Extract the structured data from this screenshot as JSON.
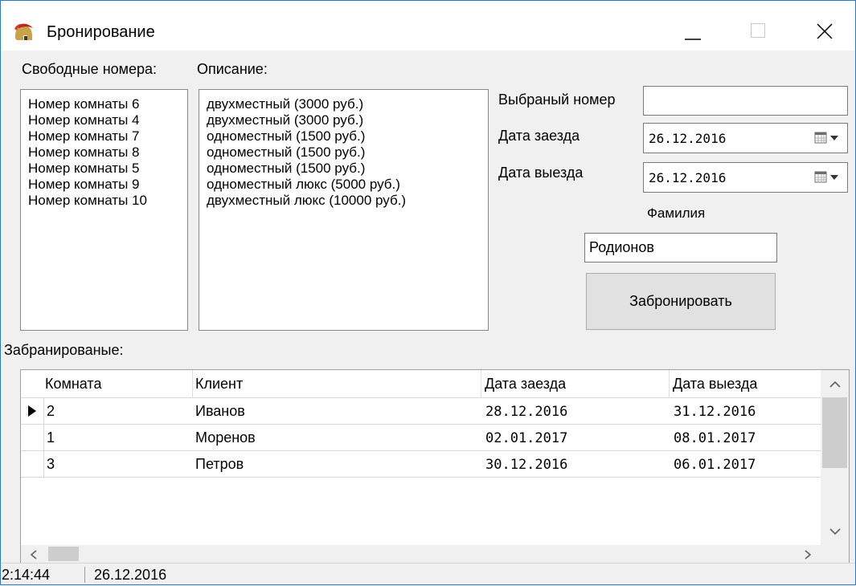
{
  "window": {
    "title": "Бронирование",
    "icon": "spartan-helmet-icon",
    "minimize_icon": "minimize-icon",
    "maximize_icon": "maximize-icon",
    "close_icon": "close-icon"
  },
  "rooms": {
    "label": "Свободные номера:",
    "items": [
      "Номер комнаты 6",
      "Номер комнаты 4",
      "Номер комнаты 7",
      "Номер комнаты 8",
      "Номер комнаты 5",
      "Номер комнаты 9",
      "Номер комнаты 10"
    ]
  },
  "description": {
    "label": "Описание:",
    "items": [
      "двухместный (3000 руб.)",
      "двухместный (3000 руб.)",
      "одноместный (1500 руб.)",
      "одноместный (1500 руб.)",
      "одноместный (1500 руб.)",
      "одноместный люкс (5000 руб.)",
      "двухместный люкс (10000 руб.)"
    ]
  },
  "form": {
    "selected_room_label": "Выбраный номер",
    "selected_room_value": "",
    "checkin_label": "Дата заезда",
    "checkin_value": "26.12.2016",
    "checkout_label": "Дата выезда",
    "checkout_value": "26.12.2016",
    "surname_label": "Фамилия",
    "surname_value": "Родионов",
    "book_button": "Забронировать"
  },
  "booked": {
    "label": "Забранированые:",
    "columns": [
      "Комната",
      "Клиент",
      "Дата заезда",
      "Дата выезда"
    ],
    "rows": [
      [
        "2",
        "Иванов",
        "28.12.2016",
        "31.12.2016"
      ],
      [
        "1",
        "Моренов",
        "02.01.2017",
        "08.01.2017"
      ],
      [
        "3",
        "Петров",
        "30.12.2016",
        "06.01.2017"
      ]
    ],
    "current_row": 0
  },
  "statusbar": {
    "time": "2:14:44",
    "date": "26.12.2016"
  },
  "colors": {
    "window_border": "#2b78c6",
    "client_bg": "#f0f0f0",
    "button_bg": "#e1e1e1"
  }
}
